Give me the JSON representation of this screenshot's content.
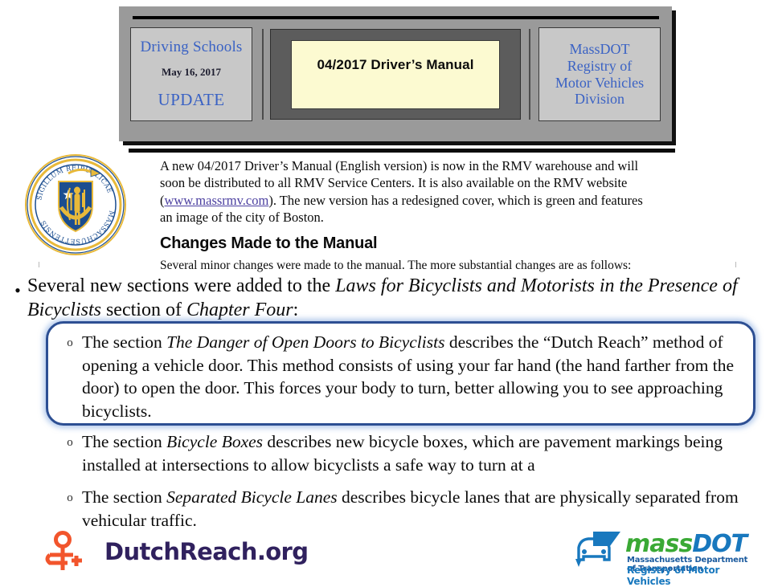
{
  "header": {
    "left_box": {
      "title": "Driving Schools",
      "date": "May 16, 2017",
      "update": "UPDATE"
    },
    "center_box": {
      "title": "04/2017 Driver’s Manual"
    },
    "right_box": {
      "line1": "MassDOT",
      "line2": "Registry of",
      "line3": "Motor Vehicles",
      "line4": "Division"
    }
  },
  "intro": {
    "paragraph_part1": "A new 04/2017 Driver’s Manual (English version) is now in the RMV warehouse and will soon be distributed to all RMV Service Centers.  It is also available on the RMV website (",
    "link_text": "www.massrmv.com",
    "paragraph_part2": ").  The new version has a redesigned cover, which is green and features an image of the city of Boston.",
    "changes_heading": "Changes Made to the Manual",
    "changes_subtext": "Several minor changes were made to the manual.  The more substantial changes are as follows:"
  },
  "main_bullet": {
    "marker": "•",
    "text_part1": "Several new sections were added to the ",
    "italic1": "Laws for Bicyclists and Motorists in the Presence of Bicyclists",
    "text_part2": " section of ",
    "italic2": "Chapter Four",
    "text_part3": ":"
  },
  "sub_items": [
    {
      "marker": "o",
      "text_part1": "The section ",
      "italic": "The Danger of Open Doors to Bicyclists",
      "text_part2": " describes the “Dutch Reach” method of opening a vehicle door.  This method consists of using your far hand (the hand farther from the door) to open the door.  This forces your body to turn, better allowing you to see approaching bicyclists.",
      "highlighted": true
    },
    {
      "marker": "o",
      "text_part1": "The section ",
      "italic": "Bicycle Boxes",
      "text_part2": " describes new bicycle boxes, which are pavement markings being installed at intersections to allow bicyclists a safe way to turn at a",
      "highlighted": false
    },
    {
      "marker": "o",
      "text_part1": "The section ",
      "italic": "Separated Bicycle Lanes",
      "text_part2": " describes bicycle lanes that are physically separated from vehicular traffic.",
      "highlighted": false
    }
  ],
  "seal": {
    "name": "massachusetts-state-seal",
    "motto_left": "MASSACHUSETTENSIS",
    "motto_right": "SIGILLUM REIPUBLICAE"
  },
  "logos": {
    "dutchreach": {
      "wordmark": "DutchReach.org",
      "icon": "dutch-reach-figure-icon"
    },
    "massdot": {
      "word_mass": "mass",
      "word_dot": "DOT",
      "tagline1": "Massachusetts Department of Transportation",
      "tagline2": "Registry of Motor Vehicles",
      "icon": "massdot-car-icon"
    }
  },
  "colors": {
    "header_banner": "#9a9a9a",
    "header_side_box": "#c8c8c8",
    "header_center_frame": "#5c5c5c",
    "header_center_yellow": "#fcfad1",
    "header_text_blue": "#3a62c4",
    "highlight_border": "#2d4f93",
    "link": "#4b3fa0",
    "dutchreach_orange": "#f2552c",
    "dutchreach_navy": "#30215e",
    "massdot_green": "#3aa935",
    "massdot_blue": "#1878be"
  }
}
